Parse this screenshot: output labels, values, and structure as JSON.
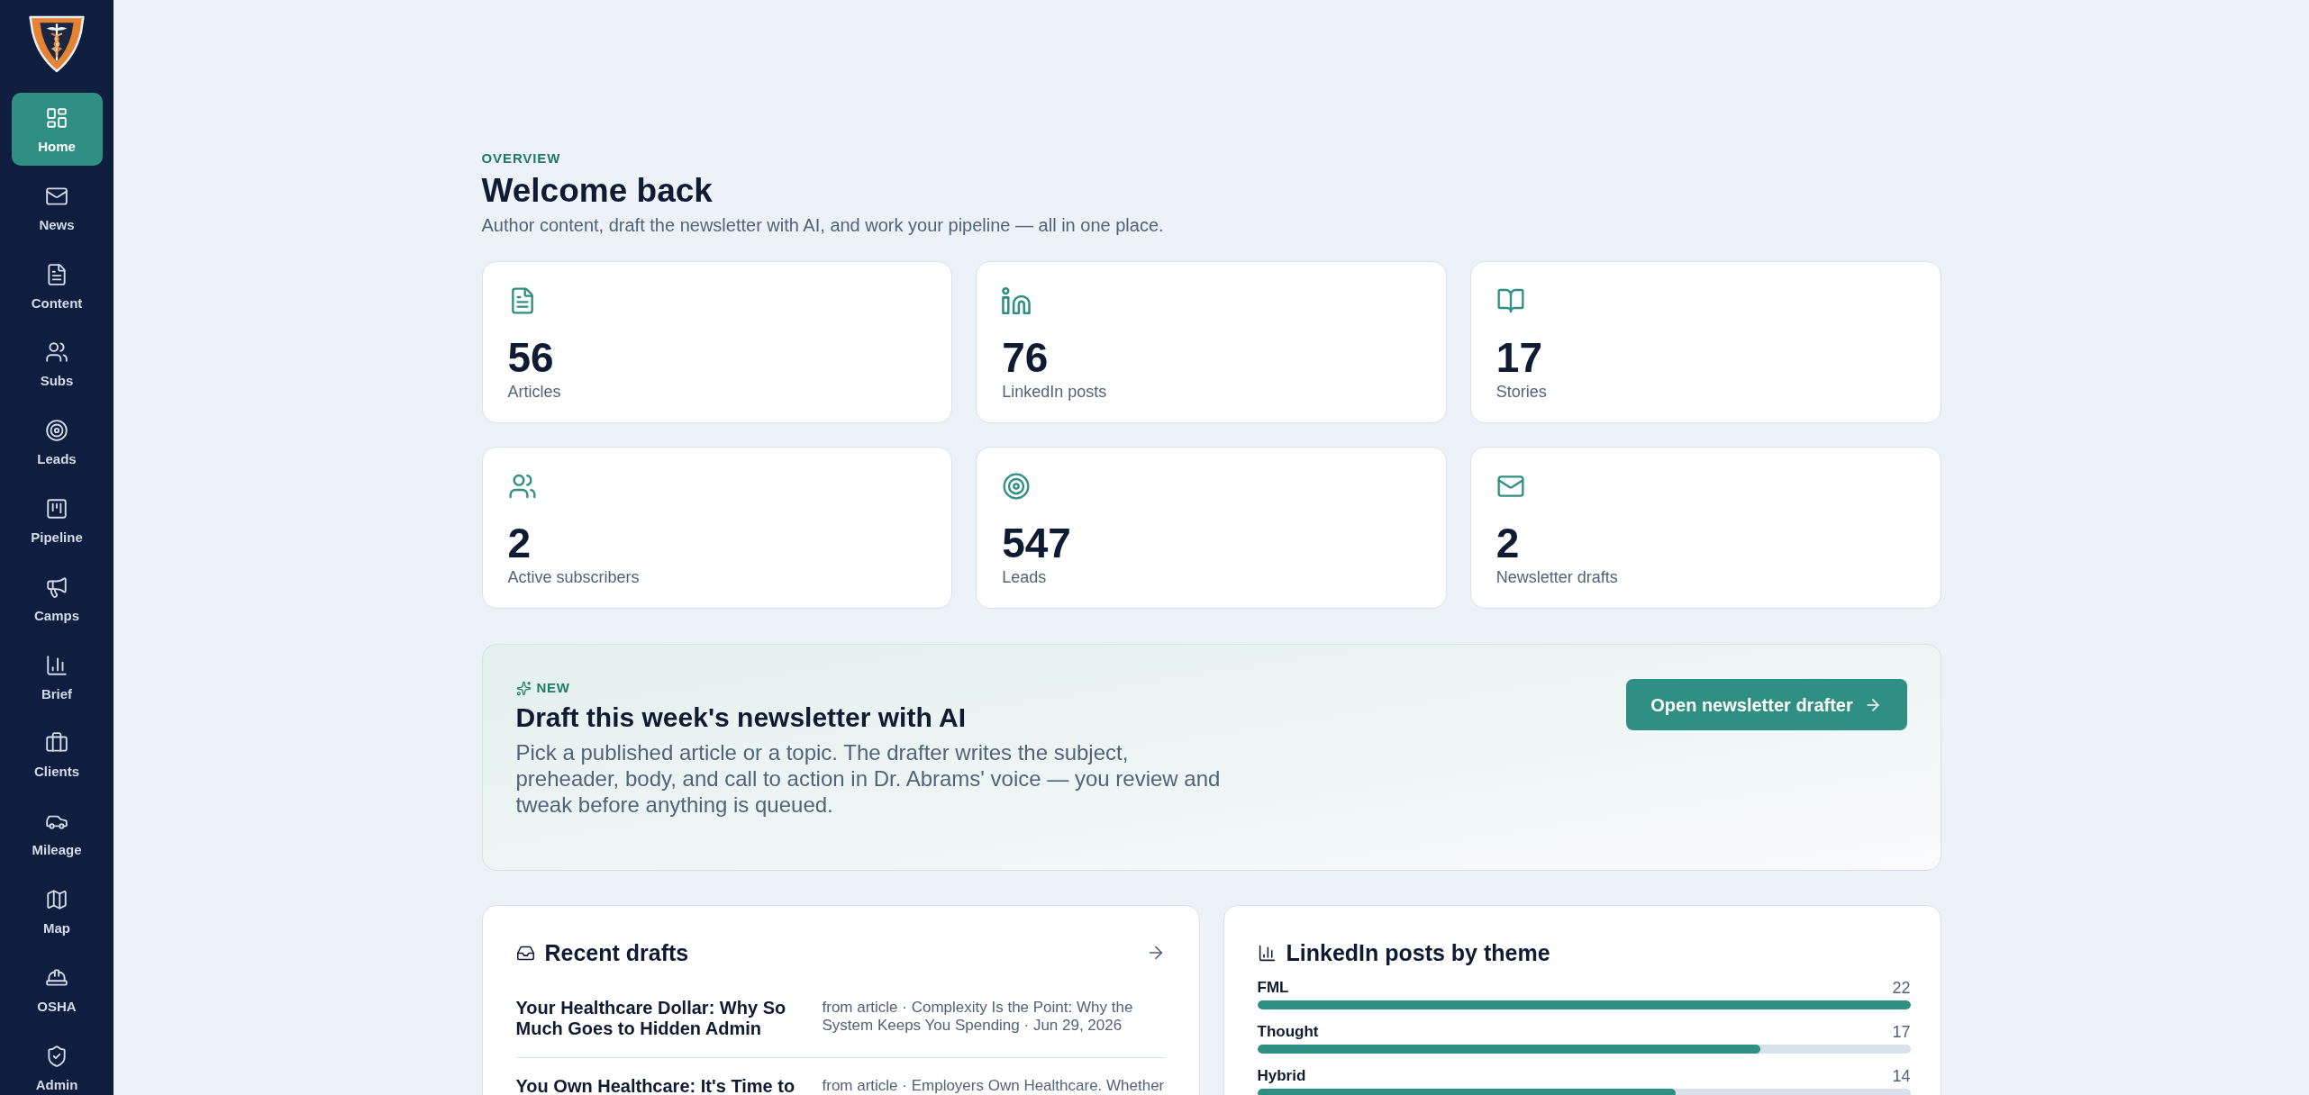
{
  "sidebar": {
    "items": [
      {
        "label": "Home",
        "selected": true
      },
      {
        "label": "News",
        "selected": false
      },
      {
        "label": "Content",
        "selected": false
      },
      {
        "label": "Subs",
        "selected": false
      },
      {
        "label": "Leads",
        "selected": false
      },
      {
        "label": "Pipeline",
        "selected": false
      },
      {
        "label": "Camps",
        "selected": false
      },
      {
        "label": "Brief",
        "selected": false
      },
      {
        "label": "Clients",
        "selected": false
      },
      {
        "label": "Mileage",
        "selected": false
      },
      {
        "label": "Map",
        "selected": false
      },
      {
        "label": "OSHA",
        "selected": false
      },
      {
        "label": "Admin",
        "selected": false
      }
    ]
  },
  "header": {
    "eyebrow": "OVERVIEW",
    "title": "Welcome back",
    "subtitle": "Author content, draft the newsletter with AI, and work your pipeline — all in one place."
  },
  "stats": [
    {
      "value": "56",
      "label": "Articles"
    },
    {
      "value": "76",
      "label": "LinkedIn posts"
    },
    {
      "value": "17",
      "label": "Stories"
    },
    {
      "value": "2",
      "label": "Active subscribers"
    },
    {
      "value": "547",
      "label": "Leads"
    },
    {
      "value": "2",
      "label": "Newsletter drafts"
    }
  ],
  "banner": {
    "badge": "NEW",
    "title": "Draft this week's newsletter with AI",
    "body": "Pick a published article or a topic. The drafter writes the subject, preheader, body, and call to action in Dr. Abrams' voice — you review and tweak before anything is queued.",
    "button": "Open newsletter drafter"
  },
  "recent_drafts": {
    "title": "Recent drafts",
    "items": [
      {
        "title": "Your Healthcare Dollar: Why So Much Goes to Hidden Admin",
        "meta": "from article · Complexity Is the Point: Why the System Keeps You Spending · Jun 29, 2026"
      },
      {
        "title": "You Own Healthcare: It's Time to",
        "meta": "from article · Employers Own Healthcare. Whether"
      }
    ]
  },
  "themes": {
    "title": "LinkedIn posts by theme",
    "rows": [
      {
        "label": "FML",
        "count": "22",
        "level": 1
      },
      {
        "label": "Thought",
        "count": "17",
        "level": 0.77
      },
      {
        "label": "Hybrid",
        "count": "14",
        "level": 0.64
      }
    ]
  }
}
